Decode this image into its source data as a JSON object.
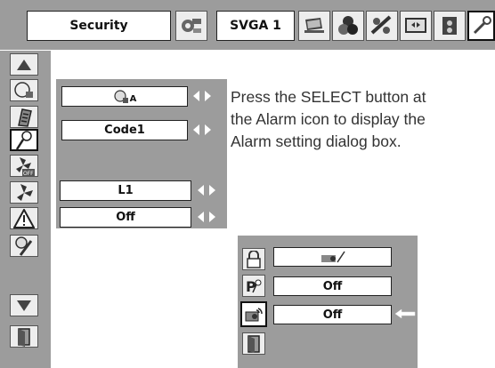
{
  "top_menu": {
    "title": "Security",
    "input_label": "SVGA 1",
    "icons": [
      "image-adjust-icon",
      "pc-adjust-icon",
      "image-select-icon",
      "color-adjust-icon",
      "screen-icon",
      "sound-icon",
      "setting-icon"
    ]
  },
  "side_menu": {
    "icons": [
      "move-up-icon",
      "lock-icon",
      "keypad-lock-icon",
      "alarm-icon",
      "fan-off-icon",
      "fan-icon",
      "warning-icon",
      "settings-wrench-icon",
      "move-down-icon",
      "exit-icon"
    ]
  },
  "submenu": {
    "rows": [
      {
        "value": "A",
        "icon": "lamp-icon"
      },
      {
        "value": "Code1"
      },
      {
        "value": "L1"
      },
      {
        "value": "Off"
      }
    ]
  },
  "instruction": {
    "lines": [
      "Press the SELECT button at",
      "the Alarm icon to display the",
      "Alarm setting dialog box."
    ]
  },
  "alarm_dialog": {
    "rows": [
      {
        "icon": "lock-icon",
        "value": "",
        "value_icon": "projector-alarm-icon"
      },
      {
        "icon": "pin-code-icon",
        "value": "Off"
      },
      {
        "icon": "alarm-sensor-icon",
        "value": "Off"
      },
      {
        "icon": "exit-icon",
        "value": ""
      }
    ]
  }
}
